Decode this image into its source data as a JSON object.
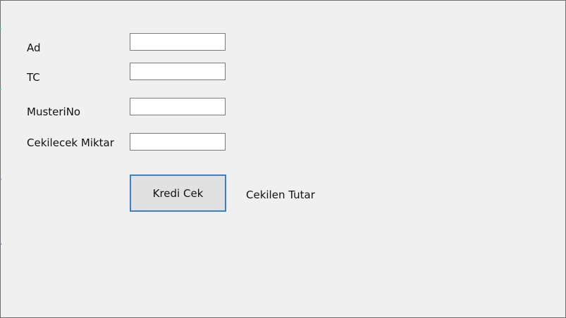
{
  "form": {
    "fields": [
      {
        "label": "Ad",
        "value": ""
      },
      {
        "label": "TC",
        "value": ""
      },
      {
        "label": "MusteriNo",
        "value": ""
      },
      {
        "label": "Cekilecek Miktar",
        "value": ""
      }
    ],
    "submit_label": "Kredi Cek",
    "result_label": "Cekilen Tutar"
  },
  "colors": {
    "background": "#f0f0f0",
    "button_border": "#3c7fc7",
    "button_fill": "#e1e1e1"
  }
}
